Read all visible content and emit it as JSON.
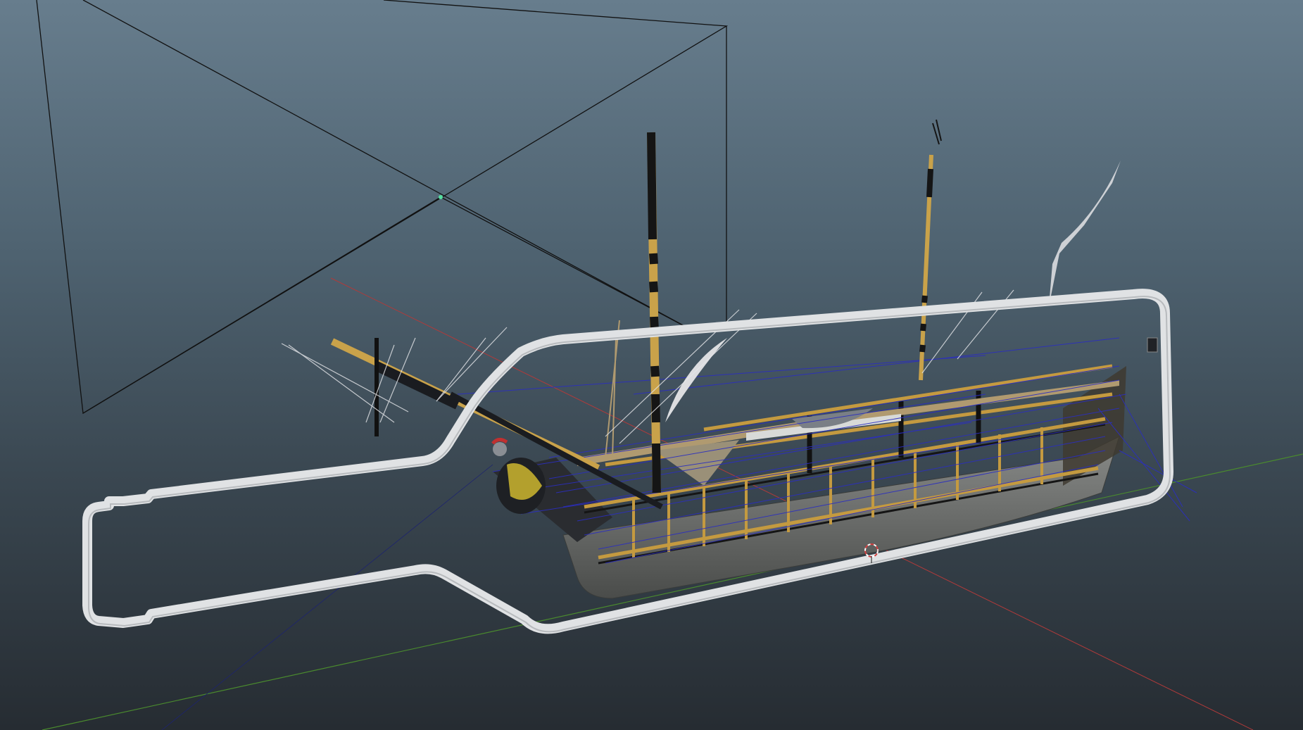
{
  "viewport": {
    "background_top": "#677d8d",
    "background_bottom": "#262c32",
    "grid_x_axis_color": "#b03a3a",
    "grid_y_axis_color": "#4a8a2e",
    "selection_color": "#d04040"
  },
  "scene": {
    "objects": [
      "camera",
      "bottle",
      "ship",
      "sail",
      "grid-axis-x",
      "grid-axis-y",
      "3d-cursor"
    ],
    "bottle_color": "#e0e2e4",
    "hull_color": "#6a6c6a",
    "frame_color": "#c49a40",
    "rigging_color": "#2b2ec0",
    "camera_color": "#111111",
    "sail_color": "#dcdde0"
  }
}
